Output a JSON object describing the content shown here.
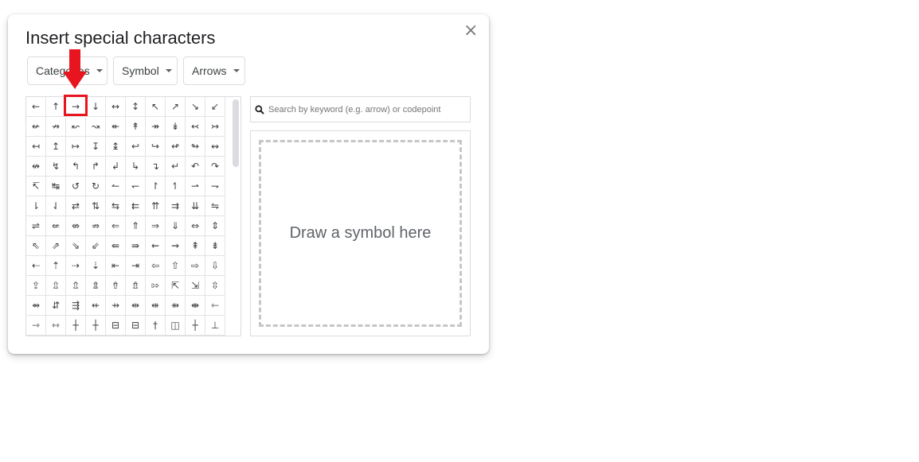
{
  "dialog": {
    "title": "Insert special characters",
    "close_label": "×"
  },
  "dropdowns": {
    "category": "Categories",
    "subcategory": "Symbol",
    "subsubcategory": "Arrows"
  },
  "grid": {
    "rows": [
      [
        "←",
        "↑",
        "→",
        "↓",
        "↔",
        "↕",
        "↖",
        "↗",
        "↘",
        "↙"
      ],
      [
        "↚",
        "↛",
        "↜",
        "↝",
        "↞",
        "↟",
        "↠",
        "↡",
        "↢",
        "↣"
      ],
      [
        "↤",
        "↥",
        "↦",
        "↧",
        "↨",
        "↩",
        "↪",
        "↫",
        "↬",
        "↭"
      ],
      [
        "↮",
        "↯",
        "↰",
        "↱",
        "↲",
        "↳",
        "↴",
        "↵",
        "↶",
        "↷"
      ],
      [
        "↸",
        "↹",
        "↺",
        "↻",
        "↼",
        "↽",
        "↾",
        "↿",
        "⇀",
        "⇁"
      ],
      [
        "⇂",
        "⇃",
        "⇄",
        "⇅",
        "⇆",
        "⇇",
        "⇈",
        "⇉",
        "⇊",
        "⇋"
      ],
      [
        "⇌",
        "⇍",
        "⇎",
        "⇏",
        "⇐",
        "⇑",
        "⇒",
        "⇓",
        "⇔",
        "⇕"
      ],
      [
        "⇖",
        "⇗",
        "⇘",
        "⇙",
        "⇚",
        "⇛",
        "⇜",
        "⇝",
        "⇞",
        "⇟"
      ],
      [
        "⇠",
        "⇡",
        "⇢",
        "⇣",
        "⇤",
        "⇥",
        "⇦",
        "⇧",
        "⇨",
        "⇩"
      ],
      [
        "⇪",
        "⇫",
        "⇬",
        "⇭",
        "⇮",
        "⇯",
        "⇰",
        "⇱",
        "⇲",
        "⇳"
      ],
      [
        "⇴",
        "⇵",
        "⇶",
        "⇷",
        "⇸",
        "⇹",
        "⇺",
        "⇻",
        "⇼",
        "⇽"
      ],
      [
        "⇾",
        "⇿",
        "┼",
        "┼",
        "⊟",
        "⊟",
        "†",
        "◫",
        "┼",
        "⊥"
      ]
    ],
    "highlighted": {
      "row": 0,
      "col": 2
    }
  },
  "search": {
    "placeholder": "Search by keyword (e.g. arrow) or codepoint",
    "icon": "search-icon"
  },
  "draw": {
    "label": "Draw a symbol here"
  },
  "annotation": {
    "color": "#e8141f",
    "icon": "down-arrow-annotation"
  }
}
